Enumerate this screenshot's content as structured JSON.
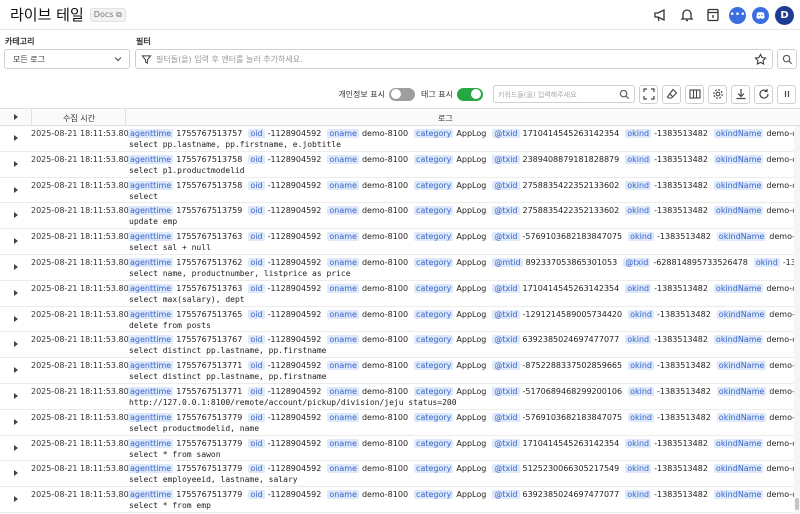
{
  "header": {
    "title": "라이브 테일",
    "docs_label": "Docs",
    "avatar_initial": "D",
    "icons": [
      "megaphone-icon",
      "bell-icon",
      "calendar-icon",
      "more-dots-icon",
      "discord-icon"
    ]
  },
  "category": {
    "label": "카테고리",
    "selected": "모든 로그"
  },
  "filter": {
    "label": "필터",
    "placeholder": "필터들(을) 입력 후 엔터를 눌러 추가하세요."
  },
  "toolbar": {
    "privacy_label": "개인정보 표시",
    "privacy_on": false,
    "tag_label": "태그 표시",
    "tag_on": true,
    "keyword_placeholder": "키워드들(을) 입력해주세요"
  },
  "table": {
    "col_time": "수집 시간",
    "col_log": "로그",
    "rows": [
      {
        "time": "2025-08-21 18:11:53.808",
        "fields": [
          [
            "agenttime",
            "1755767513757"
          ],
          [
            "oid",
            "-1128904592"
          ],
          [
            "oname",
            "demo-8100"
          ],
          [
            "category",
            "AppLog"
          ],
          [
            "@txid",
            "1710414545263142354"
          ],
          [
            "okind",
            "-1383513482"
          ],
          [
            "okindName",
            "demo-okind-0"
          ]
        ],
        "sql": "select pp.lastname, pp.firstname, e.jobtitle"
      },
      {
        "time": "2025-08-21 18:11:53.808",
        "fields": [
          [
            "agenttime",
            "1755767513758"
          ],
          [
            "oid",
            "-1128904592"
          ],
          [
            "oname",
            "demo-8100"
          ],
          [
            "category",
            "AppLog"
          ],
          [
            "@txid",
            "2389408879181828879"
          ],
          [
            "okind",
            "-1383513482"
          ],
          [
            "okindName",
            "demo-okind-0"
          ]
        ],
        "sql": "select p1.productmodelid"
      },
      {
        "time": "2025-08-21 18:11:53.808",
        "fields": [
          [
            "agenttime",
            "1755767513758"
          ],
          [
            "oid",
            "-1128904592"
          ],
          [
            "oname",
            "demo-8100"
          ],
          [
            "category",
            "AppLog"
          ],
          [
            "@txid",
            "2758835422352133602"
          ],
          [
            "okind",
            "-1383513482"
          ],
          [
            "okindName",
            "demo-okind-0"
          ]
        ],
        "sql": "select"
      },
      {
        "time": "2025-08-21 18:11:53.808",
        "fields": [
          [
            "agenttime",
            "1755767513759"
          ],
          [
            "oid",
            "-1128904592"
          ],
          [
            "oname",
            "demo-8100"
          ],
          [
            "category",
            "AppLog"
          ],
          [
            "@txid",
            "2758835422352133602"
          ],
          [
            "okind",
            "-1383513482"
          ],
          [
            "okindName",
            "demo-okind-0"
          ]
        ],
        "sql": "update emp"
      },
      {
        "time": "2025-08-21 18:11:53.808",
        "fields": [
          [
            "agenttime",
            "1755767513763"
          ],
          [
            "oid",
            "-1128904592"
          ],
          [
            "oname",
            "demo-8100"
          ],
          [
            "category",
            "AppLog"
          ],
          [
            "@txid",
            "-5769103682183847075"
          ],
          [
            "okind",
            "-1383513482"
          ],
          [
            "okindName",
            "demo-okind-0"
          ]
        ],
        "sql": "select sal + null"
      },
      {
        "time": "2025-08-21 18:11:53.808",
        "fields": [
          [
            "agenttime",
            "1755767513762"
          ],
          [
            "oid",
            "-1128904592"
          ],
          [
            "oname",
            "demo-8100"
          ],
          [
            "category",
            "AppLog"
          ],
          [
            "@mtid",
            "892337053865301053"
          ],
          [
            "@txid",
            "-628814895733526478"
          ],
          [
            "okind",
            "-1383513482"
          ]
        ],
        "sql": "select name, productnumber, listprice as price"
      },
      {
        "time": "2025-08-21 18:11:53.808",
        "fields": [
          [
            "agenttime",
            "1755767513763"
          ],
          [
            "oid",
            "-1128904592"
          ],
          [
            "oname",
            "demo-8100"
          ],
          [
            "category",
            "AppLog"
          ],
          [
            "@txid",
            "1710414545263142354"
          ],
          [
            "okind",
            "-1383513482"
          ],
          [
            "okindName",
            "demo-okind-0"
          ]
        ],
        "sql": "select max(salary), dept"
      },
      {
        "time": "2025-08-21 18:11:53.808",
        "fields": [
          [
            "agenttime",
            "1755767513765"
          ],
          [
            "oid",
            "-1128904592"
          ],
          [
            "oname",
            "demo-8100"
          ],
          [
            "category",
            "AppLog"
          ],
          [
            "@txid",
            "-1291214589005734420"
          ],
          [
            "okind",
            "-1383513482"
          ],
          [
            "okindName",
            "demo-okind-0"
          ]
        ],
        "sql": "delete from posts"
      },
      {
        "time": "2025-08-21 18:11:53.808",
        "fields": [
          [
            "agenttime",
            "1755767513767"
          ],
          [
            "oid",
            "-1128904592"
          ],
          [
            "oname",
            "demo-8100"
          ],
          [
            "category",
            "AppLog"
          ],
          [
            "@txid",
            "6392385024697477077"
          ],
          [
            "okind",
            "-1383513482"
          ],
          [
            "okindName",
            "demo-okind-0"
          ]
        ],
        "sql": "select distinct pp.lastname, pp.firstname"
      },
      {
        "time": "2025-08-21 18:11:53.808",
        "fields": [
          [
            "agenttime",
            "1755767513771"
          ],
          [
            "oid",
            "-1128904592"
          ],
          [
            "oname",
            "demo-8100"
          ],
          [
            "category",
            "AppLog"
          ],
          [
            "@txid",
            "-8752288337502859665"
          ],
          [
            "okind",
            "-1383513482"
          ],
          [
            "okindName",
            "demo-okind-0"
          ]
        ],
        "sql": "select distinct pp.lastname, pp.firstname"
      },
      {
        "time": "2025-08-21 18:11:53.808",
        "fields": [
          [
            "agenttime",
            "1755767513771"
          ],
          [
            "oid",
            "-1128904592"
          ],
          [
            "oname",
            "demo-8100"
          ],
          [
            "category",
            "AppLog"
          ],
          [
            "@txid",
            "-5170689468299200106"
          ],
          [
            "okind",
            "-1383513482"
          ],
          [
            "okindName",
            "demo-okind-0"
          ]
        ],
        "sql": "http://127.0.0.1:8100/remote/account/pickup/division/jeju status=200"
      },
      {
        "time": "2025-08-21 18:11:53.808",
        "fields": [
          [
            "agenttime",
            "1755767513779"
          ],
          [
            "oid",
            "-1128904592"
          ],
          [
            "oname",
            "demo-8100"
          ],
          [
            "category",
            "AppLog"
          ],
          [
            "@txid",
            "-5769103682183847075"
          ],
          [
            "okind",
            "-1383513482"
          ],
          [
            "okindName",
            "demo-okind-0"
          ]
        ],
        "sql": "select productmodelid, name"
      },
      {
        "time": "2025-08-21 18:11:53.808",
        "fields": [
          [
            "agenttime",
            "1755767513779"
          ],
          [
            "oid",
            "-1128904592"
          ],
          [
            "oname",
            "demo-8100"
          ],
          [
            "category",
            "AppLog"
          ],
          [
            "@txid",
            "1710414545263142354"
          ],
          [
            "okind",
            "-1383513482"
          ],
          [
            "okindName",
            "demo-okind-0"
          ]
        ],
        "sql": "select * from sawon"
      },
      {
        "time": "2025-08-21 18:11:53.808",
        "fields": [
          [
            "agenttime",
            "1755767513779"
          ],
          [
            "oid",
            "-1128904592"
          ],
          [
            "oname",
            "demo-8100"
          ],
          [
            "category",
            "AppLog"
          ],
          [
            "@txid",
            "5125230066305217549"
          ],
          [
            "okind",
            "-1383513482"
          ],
          [
            "okindName",
            "demo-okind-0"
          ]
        ],
        "sql": "select employeeid, lastname, salary"
      },
      {
        "time": "2025-08-21 18:11:53.808",
        "fields": [
          [
            "agenttime",
            "1755767513779"
          ],
          [
            "oid",
            "-1128904592"
          ],
          [
            "oname",
            "demo-8100"
          ],
          [
            "category",
            "AppLog"
          ],
          [
            "@txid",
            "6392385024697477077"
          ],
          [
            "okind",
            "-1383513482"
          ],
          [
            "okindName",
            "demo-okind-0"
          ]
        ],
        "sql": "select * from emp"
      }
    ]
  }
}
